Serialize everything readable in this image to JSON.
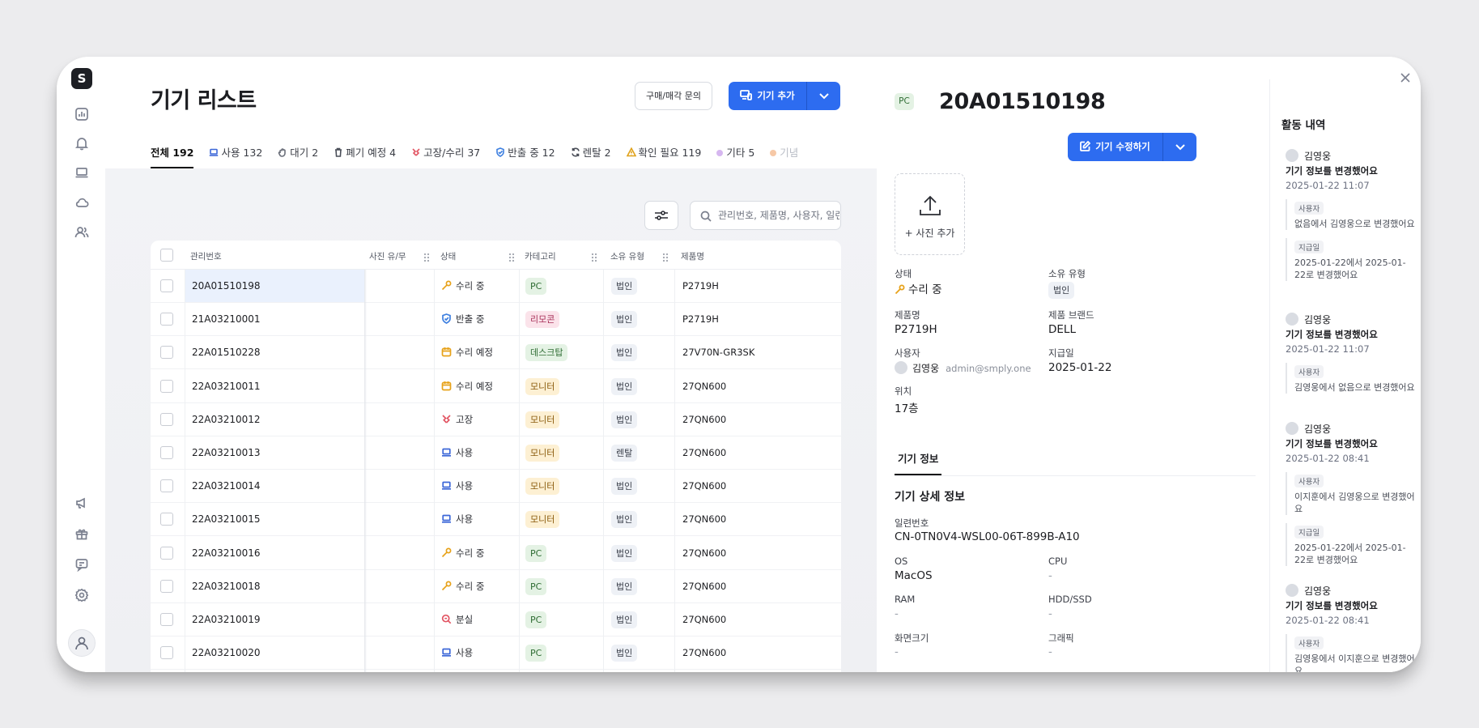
{
  "rail": {
    "logo": "S",
    "icons": [
      "dashboard-icon",
      "bell-icon",
      "laptop-icon",
      "cloud-icon",
      "users-icon",
      "megaphone-icon",
      "gift-icon",
      "chat-icon",
      "settings-icon",
      "profile-icon"
    ]
  },
  "header": {
    "title": "기기 리스트",
    "inquiry_button": "구매/매각 문의",
    "add_button": "기기 추가"
  },
  "tabs": [
    {
      "label": "전체 192",
      "icon": "",
      "active": true
    },
    {
      "label": "사용 132",
      "icon": "laptop"
    },
    {
      "label": "대기 2",
      "icon": "hand"
    },
    {
      "label": "폐기 예정 4",
      "icon": "trash"
    },
    {
      "label": "고장/수리 37",
      "icon": "broken"
    },
    {
      "label": "반출 중 12",
      "icon": "shield"
    },
    {
      "label": "렌탈 2",
      "icon": "refresh"
    },
    {
      "label": "확인 필요 119",
      "icon": "warning"
    },
    {
      "label": "기타 5",
      "icon": "dot-purple"
    },
    {
      "label": "기념",
      "icon": "dot-orange"
    }
  ],
  "search": {
    "placeholder": "관리번호, 제품명, 사용자, 일련번호"
  },
  "table": {
    "columns": [
      "관리번호",
      "사진 유/무",
      "상태",
      "카테고리",
      "소유 유형",
      "제품명"
    ],
    "rows": [
      {
        "id": "20A01510198",
        "status": "수리 중",
        "status_icon": "wrench",
        "category": "PC",
        "ownership": "법인",
        "product": "P2719H",
        "selected": true
      },
      {
        "id": "21A03210001",
        "status": "반출 중",
        "status_icon": "shield",
        "category": "리모콘",
        "ownership": "법인",
        "product": "P2719H"
      },
      {
        "id": "22A01510228",
        "status": "수리 예정",
        "status_icon": "calendar",
        "category": "데스크탑",
        "ownership": "법인",
        "product": "27V70N-GR3SK"
      },
      {
        "id": "22A03210011",
        "status": "수리 예정",
        "status_icon": "calendar",
        "category": "모니터",
        "ownership": "법인",
        "product": "27QN600"
      },
      {
        "id": "22A03210012",
        "status": "고장",
        "status_icon": "broken",
        "category": "모니터",
        "ownership": "법인",
        "product": "27QN600"
      },
      {
        "id": "22A03210013",
        "status": "사용",
        "status_icon": "laptop",
        "category": "모니터",
        "ownership": "렌탈",
        "product": "27QN600"
      },
      {
        "id": "22A03210014",
        "status": "사용",
        "status_icon": "laptop",
        "category": "모니터",
        "ownership": "법인",
        "product": "27QN600"
      },
      {
        "id": "22A03210015",
        "status": "사용",
        "status_icon": "laptop",
        "category": "모니터",
        "ownership": "법인",
        "product": "27QN600"
      },
      {
        "id": "22A03210016",
        "status": "수리 중",
        "status_icon": "wrench",
        "category": "PC",
        "ownership": "법인",
        "product": "27QN600"
      },
      {
        "id": "22A03210018",
        "status": "수리 중",
        "status_icon": "wrench",
        "category": "PC",
        "ownership": "법인",
        "product": "27QN600"
      },
      {
        "id": "22A03210019",
        "status": "분실",
        "status_icon": "search",
        "category": "PC",
        "ownership": "법인",
        "product": "27QN600"
      },
      {
        "id": "22A03210020",
        "status": "사용",
        "status_icon": "laptop",
        "category": "PC",
        "ownership": "법인",
        "product": "27QN600"
      }
    ]
  },
  "category_colors": {
    "PC": {
      "bg": "#e4f2e4",
      "fg": "#2f6d34"
    },
    "리모콘": {
      "bg": "#fbe3ea",
      "fg": "#a8325a"
    },
    "데스크탑": {
      "bg": "#e4f2e4",
      "fg": "#2f6d34"
    },
    "모니터": {
      "bg": "#fdf0d3",
      "fg": "#8a5a0b"
    }
  },
  "detail": {
    "badge": "PC",
    "title": "20A01510198",
    "edit_button": "기기 수정하기",
    "photo_label": "+ 사진 추가",
    "fields": {
      "status_label": "상태",
      "status_value": "수리 중",
      "ownership_label": "소유 유형",
      "ownership_value": "법인",
      "product_label": "제품명",
      "product_value": "P2719H",
      "brand_label": "제품 브랜드",
      "brand_value": "DELL",
      "user_label": "사용자",
      "user_name": "김영웅",
      "user_email": "admin@smply.one",
      "issued_label": "지급일",
      "issued_value": "2025-01-22",
      "location_label": "위치",
      "location_value": "17층"
    },
    "tab": "기기 정보",
    "section_title": "기기 상세 정보",
    "specs": {
      "serial_label": "일련번호",
      "serial_value": "CN-0TN0V4-WSL00-06T-899B-A10",
      "os_label": "OS",
      "os_value": "MacOS",
      "cpu_label": "CPU",
      "cpu_value": "-",
      "ram_label": "RAM",
      "ram_value": "-",
      "disk_label": "HDD/SSD",
      "disk_value": "-",
      "screen_label": "화면크기",
      "screen_value": "-",
      "gpu_label": "그래픽",
      "gpu_value": "-"
    }
  },
  "activity": {
    "title": "활동 내역",
    "items": [
      {
        "user": "김영웅",
        "action": "기기 정보를 변경했어요",
        "time": "2025-01-22 11:07",
        "changes": [
          {
            "tag": "사용자",
            "text": "없음에서 김영웅으로 변경했어요"
          },
          {
            "tag": "지급일",
            "text": "2025-01-22에서 2025-01-22로 변경했어요"
          }
        ]
      },
      {
        "user": "김영웅",
        "action": "기기 정보를 변경했어요",
        "time": "2025-01-22 11:07",
        "changes": [
          {
            "tag": "사용자",
            "text": "김영웅에서 없음으로 변경했어요"
          }
        ]
      },
      {
        "user": "김영웅",
        "action": "기기 정보를 변경했어요",
        "time": "2025-01-22 08:41",
        "changes": [
          {
            "tag": "사용자",
            "text": "이지훈에서 김영웅으로 변경했어요"
          },
          {
            "tag": "지급일",
            "text": "2025-01-22에서 2025-01-22로 변경했어요"
          }
        ]
      },
      {
        "user": "김영웅",
        "action": "기기 정보를 변경했어요",
        "time": "2025-01-22 08:41",
        "changes": [
          {
            "tag": "사용자",
            "text": "김영웅에서 이지훈으로 변경했어요"
          }
        ]
      }
    ]
  }
}
